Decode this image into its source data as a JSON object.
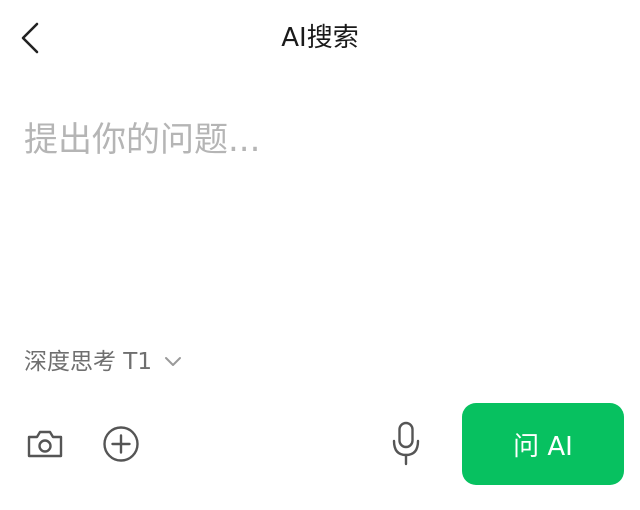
{
  "header": {
    "title": "AI搜索",
    "back_icon": "chevron-left-icon"
  },
  "composer": {
    "placeholder": "提出你的问题...",
    "value": ""
  },
  "model_selector": {
    "label": "深度思考 T1",
    "icon": "chevron-down-icon"
  },
  "toolbar": {
    "camera_icon": "camera-icon",
    "add_icon": "plus-circle-icon",
    "mic_icon": "microphone-icon",
    "ask_label": "问 AI"
  },
  "colors": {
    "accent": "#07c160",
    "placeholder": "#b5b5b5",
    "secondary_text": "#6f6f6f",
    "icon": "#555555",
    "title_text": "#1a1a1a"
  }
}
